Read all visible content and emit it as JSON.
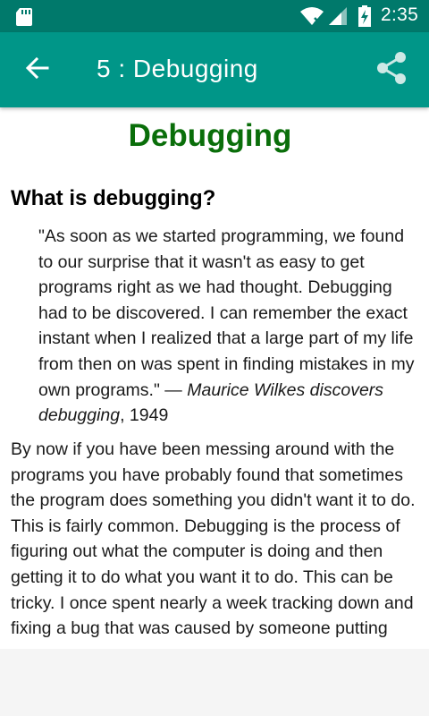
{
  "status_bar": {
    "time": "2:35",
    "icons": [
      "sd-card-icon",
      "wifi-icon",
      "signal-icon",
      "battery-charging-icon"
    ]
  },
  "app_bar": {
    "title": "5 : Debugging",
    "back_icon": "arrow-left-icon",
    "share_icon": "share-icon"
  },
  "article": {
    "heading": "Debugging",
    "heading_color": "#0a6e0a",
    "section_title": "What is debugging?",
    "quote": {
      "text": "\"As soon as we started programming, we found to our surprise that it wasn't as easy to get programs right as we had thought. Debugging had to be discovered. I can remember the exact instant when I realized that a large part of my life from then on was spent in finding mistakes in my own programs.\" — ",
      "attribution": "Maurice Wilkes discovers debugging",
      "year": ", 1949"
    },
    "body": "By now if you have been messing around with the programs you have probably found that sometimes the program does something you didn't want it to do. This is fairly common. Debugging is the process of figuring out what the computer is doing and then getting it to do what you want it to do. This can be tricky. I once spent nearly a week tracking down and fixing a bug that was caused by someone putting"
  },
  "colors": {
    "status_bar": "#00796b",
    "app_bar": "#009688"
  }
}
